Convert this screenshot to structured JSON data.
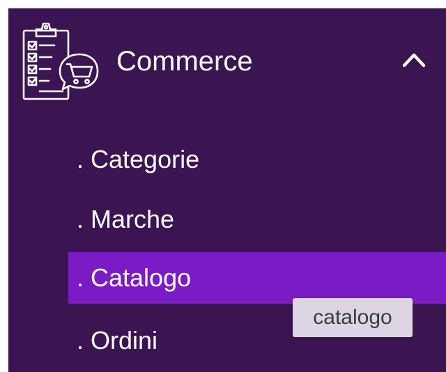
{
  "sidebar": {
    "section": {
      "title": "Commerce",
      "icon": "clipboard-cart-icon",
      "expanded_icon": "chevron-up-icon"
    },
    "items": [
      {
        "label": ". Categorie",
        "active": false
      },
      {
        "label": ". Marche",
        "active": false
      },
      {
        "label": ". Catalogo",
        "active": true
      },
      {
        "label": ". Ordini",
        "active": false
      }
    ]
  },
  "tooltip": {
    "text": "catalogo"
  },
  "colors": {
    "sidebar_background": "#3b1552",
    "active_item_background": "#7a1bc6",
    "text": "#ffffff",
    "tooltip_background": "#ddd5e4",
    "tooltip_text": "#3a3a3a"
  }
}
